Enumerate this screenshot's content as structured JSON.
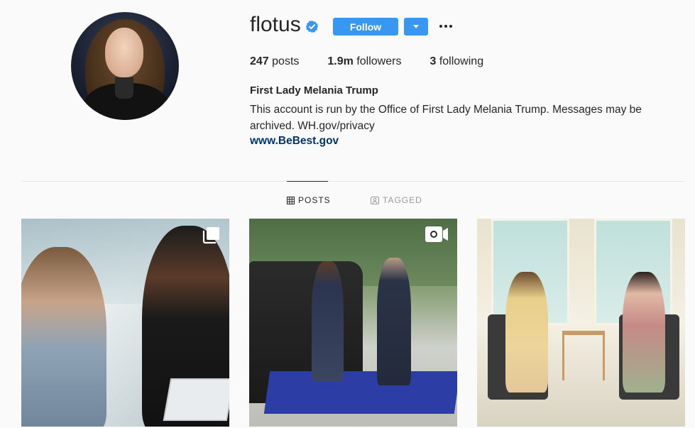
{
  "profile": {
    "username": "flotus",
    "verified_icon": "verified-badge-icon",
    "follow_label": "Follow",
    "stats": {
      "posts_count": "247",
      "posts_label": "posts",
      "followers_count": "1.9m",
      "followers_label": "followers",
      "following_count": "3",
      "following_label": "following"
    },
    "full_name": "First Lady Melania Trump",
    "bio": "This account is run by the Office of First Lady Melania Trump. Messages may be archived. WH.gov/privacy",
    "website": "www.BeBest.gov"
  },
  "tabs": [
    {
      "label": "POSTS",
      "icon": "grid-icon",
      "active": true
    },
    {
      "label": "TAGGED",
      "icon": "tag-portrait-icon",
      "active": false
    }
  ],
  "posts": [
    {
      "type_icon": "carousel-icon"
    },
    {
      "type_icon": "video-icon"
    },
    {
      "type_icon": ""
    }
  ],
  "colors": {
    "accent": "#3897f0",
    "link": "#003569",
    "text": "#262626",
    "muted": "#999999"
  }
}
